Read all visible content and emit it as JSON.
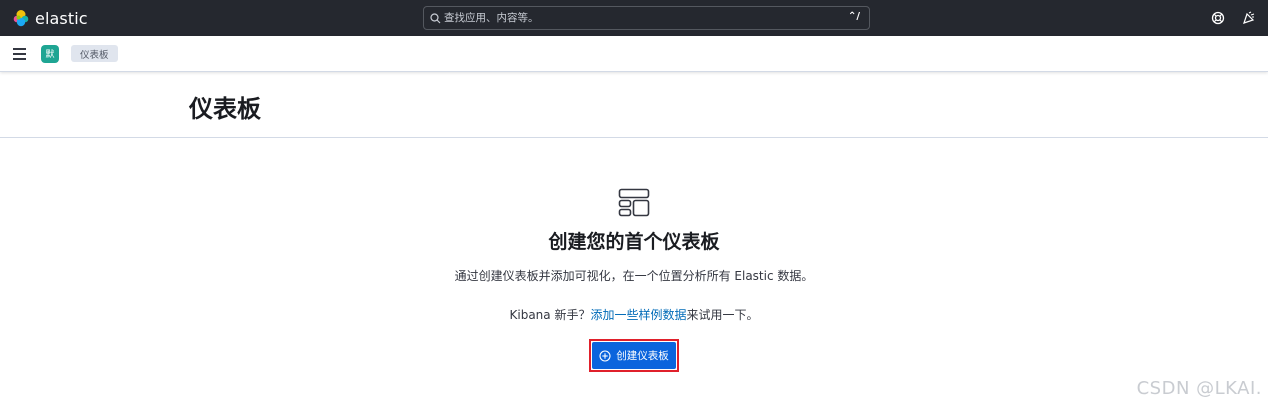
{
  "header": {
    "logo_text": "elastic",
    "search_placeholder": "查找应用、内容等。",
    "search_shortcut": "⌃/",
    "icons": [
      "help-icon",
      "news-icon"
    ]
  },
  "subbar": {
    "space_initial": "默",
    "breadcrumb": "仪表板"
  },
  "page": {
    "title": "仪表板"
  },
  "empty_prompt": {
    "icon": "dashboard-icon",
    "title": "创建您的首个仪表板",
    "description": "通过创建仪表板并添加可视化，在一个位置分析所有 Elastic 数据。",
    "new_prefix": "Kibana 新手？",
    "sample_link": "添加一些样例数据",
    "new_suffix": "来试用一下。",
    "create_button": "创建仪表板"
  },
  "watermark": "CSDN @LKAI.",
  "colors": {
    "header_bg": "#25282f",
    "primary": "#0b64dd",
    "link": "#006bb8",
    "space_avatar": "#1ea593",
    "highlight_border": "#e0202b"
  }
}
